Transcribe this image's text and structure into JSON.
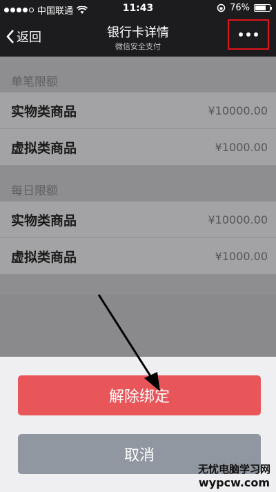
{
  "status_bar": {
    "carrier": "中国联通",
    "time": "11:43",
    "battery": "76%",
    "battery_level": 0.76
  },
  "nav": {
    "back_label": "返回",
    "title": "银行卡详情",
    "subtitle": "微信安全支付"
  },
  "sections": [
    {
      "header": "单笔限额",
      "rows": [
        {
          "label": "实物类商品",
          "value": "¥10000.00"
        },
        {
          "label": "虚拟类商品",
          "value": "¥1000.00"
        }
      ]
    },
    {
      "header": "每日限额",
      "rows": [
        {
          "label": "实物类商品",
          "value": "¥10000.00"
        },
        {
          "label": "虚拟类商品",
          "value": "¥1000.00"
        }
      ]
    }
  ],
  "action_sheet": {
    "unbind_label": "解除绑定",
    "cancel_label": "取消"
  },
  "watermark": {
    "line1": "无忧电脑学习网",
    "line2": "wypcw.com"
  },
  "colors": {
    "highlight": "#e0141b",
    "unbind_button": "#e9565a",
    "cancel_button": "#9197a1"
  }
}
